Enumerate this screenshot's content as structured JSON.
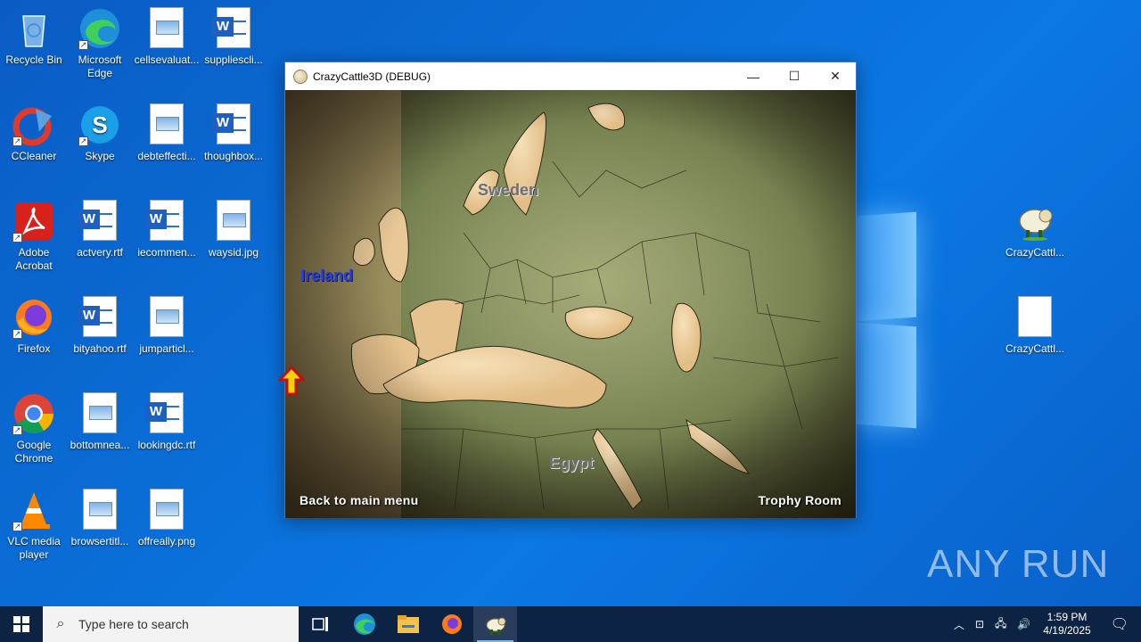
{
  "desktop": {
    "icons": [
      {
        "label": "Recycle Bin"
      },
      {
        "label": "Microsoft Edge"
      },
      {
        "label": "cellsevaluat..."
      },
      {
        "label": "suppliescli..."
      },
      {
        "label": "CCleaner"
      },
      {
        "label": "Skype"
      },
      {
        "label": "debteffecti..."
      },
      {
        "label": "thoughbox..."
      },
      {
        "label": "Adobe Acrobat"
      },
      {
        "label": "actvery.rtf"
      },
      {
        "label": "iecommen..."
      },
      {
        "label": "waysid.jpg"
      },
      {
        "label": "Firefox"
      },
      {
        "label": "bityahoo.rtf"
      },
      {
        "label": "jumparticl..."
      },
      {
        "label": "Google Chrome"
      },
      {
        "label": "bottomnea..."
      },
      {
        "label": "lookingdc.rtf"
      },
      {
        "label": "VLC media player"
      },
      {
        "label": "browsertitl..."
      },
      {
        "label": "offreally.png"
      },
      {
        "label": "CrazyCattl..."
      },
      {
        "label": "CrazyCattl..."
      }
    ]
  },
  "window": {
    "title": "CrazyCattle3D (DEBUG)",
    "minimize": "—",
    "maximize": "☐",
    "close": "✕"
  },
  "game": {
    "labels": {
      "sweden": "Sweden",
      "ireland": "Ireland",
      "egypt": "Egypt"
    },
    "back": "Back to main menu",
    "trophy": "Trophy Room"
  },
  "watermark": "ANY RUN",
  "taskbar": {
    "search_placeholder": "Type here to search",
    "time": "1:59 PM",
    "date": "4/19/2025"
  },
  "colors": {
    "desktop": "#0a6fd8",
    "taskbar": "#0d2344",
    "ireland": "#2a3fd6",
    "sweden": "#6e6e6e"
  }
}
